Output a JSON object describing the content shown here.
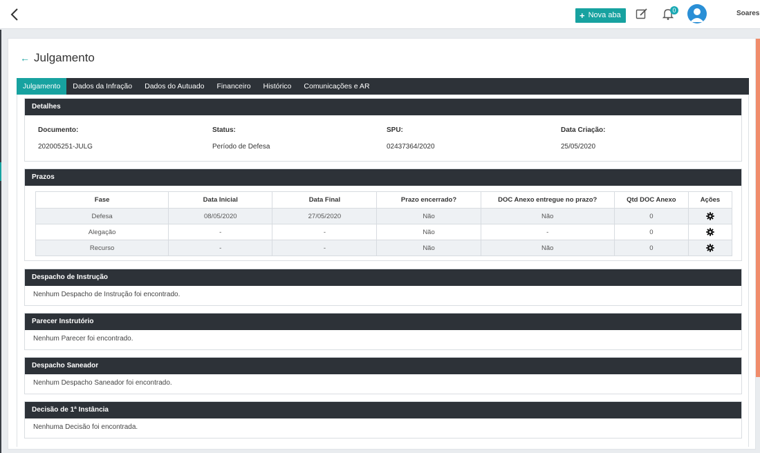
{
  "header": {
    "nova_aba_label": "Nova aba",
    "notification_count": "0",
    "username": "Soares"
  },
  "page": {
    "title": "Julgamento"
  },
  "tabs": [
    {
      "label": "Julgamento",
      "active": true
    },
    {
      "label": "Dados da Infração"
    },
    {
      "label": "Dados do Autuado"
    },
    {
      "label": "Financeiro"
    },
    {
      "label": "Histórico"
    },
    {
      "label": "Comunicações e AR"
    }
  ],
  "detalhes": {
    "title": "Detalhes",
    "fields": [
      {
        "label": "Documento:",
        "value": "202005251-JULG"
      },
      {
        "label": "Status:",
        "value": "Período de Defesa"
      },
      {
        "label": "SPU:",
        "value": "02437364/2020"
      },
      {
        "label": "Data Criação:",
        "value": "25/05/2020"
      }
    ]
  },
  "prazos": {
    "title": "Prazos",
    "columns": [
      "Fase",
      "Data Inicial",
      "Data Final",
      "Prazo encerrado?",
      "DOC Anexo entregue no prazo?",
      "Qtd DOC Anexo",
      "Ações"
    ],
    "rows": [
      [
        "Defesa",
        "08/05/2020",
        "27/05/2020",
        "Não",
        "Não",
        "0"
      ],
      [
        "Alegação",
        "-",
        "-",
        "Não",
        "-",
        "0"
      ],
      [
        "Recurso",
        "-",
        "-",
        "Não",
        "Não",
        "0"
      ]
    ]
  },
  "despacho_instrucao": {
    "title": "Despacho de Instrução",
    "empty": "Nenhum Despacho de Instrução foi encontrado."
  },
  "parecer": {
    "title": "Parecer Instrutório",
    "empty": "Nenhum Parecer foi encontrado."
  },
  "despacho_saneador": {
    "title": "Despacho Saneador",
    "empty": "Nenhum Despacho Saneador foi encontrado."
  },
  "decisao": {
    "title": "Decisão de 1ª Instância",
    "empty": "Nenhuma Decisão foi encontrada."
  },
  "icons": {
    "back": "chevron-left-icon",
    "edit": "edit-icon",
    "bell": "bell-icon",
    "gear": "gear-icon",
    "accent_color": "#17a2a0"
  }
}
